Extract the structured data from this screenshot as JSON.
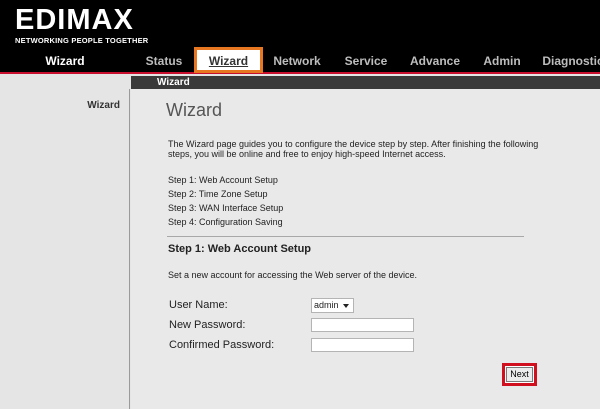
{
  "brand": {
    "name": "EDIMAX",
    "tagline": "NETWORKING PEOPLE TOGETHER"
  },
  "nav": {
    "current_section": "Wizard",
    "tabs": [
      {
        "label": "Status"
      },
      {
        "label": "Wizard",
        "active": true
      },
      {
        "label": "Network"
      },
      {
        "label": "Service"
      },
      {
        "label": "Advance"
      },
      {
        "label": "Admin"
      },
      {
        "label": "Diagnostic"
      }
    ]
  },
  "subbar": {
    "title": "Wizard"
  },
  "sidebar": {
    "items": [
      {
        "label": "Wizard"
      }
    ]
  },
  "main": {
    "title": "Wizard",
    "description": "The Wizard page guides you to configure the device step by step. After finishing the following steps, you will be online and free to enjoy high-speed Internet access.",
    "steps": [
      "Step 1: Web Account Setup",
      "Step 2: Time Zone Setup",
      "Step 3: WAN Interface Setup",
      "Step 4: Configuration Saving"
    ],
    "section_title": "Step 1: Web Account Setup",
    "section_description": "Set a new account for accessing the Web server of the device.",
    "form": {
      "username_label": "User Name:",
      "username_value": "admin",
      "new_password_label": "New Password:",
      "new_password_value": "",
      "confirm_password_label": "Confirmed Password:",
      "confirm_password_value": ""
    },
    "next_button": "Next"
  },
  "colors": {
    "header_bg": "#000000",
    "nav_underline": "#c8102e",
    "active_tab_highlight": "#e87722",
    "next_highlight": "#d0101e"
  }
}
